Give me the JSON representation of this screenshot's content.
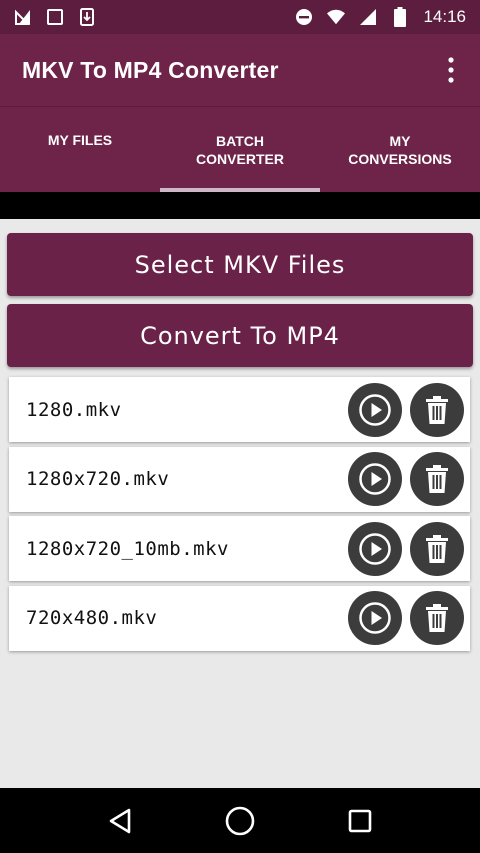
{
  "status_bar": {
    "time": "14:16",
    "icons_left": [
      "no-signal-icon",
      "square-icon",
      "download-icon"
    ],
    "icons_right": [
      "do-not-disturb-icon",
      "wifi-icon",
      "signal-icon",
      "battery-icon"
    ]
  },
  "app_bar": {
    "title": "MKV To MP4 Converter",
    "menu_icon": "overflow-menu-icon"
  },
  "tabs": [
    {
      "label": "MY FILES",
      "active": false
    },
    {
      "label": "BATCH\nCONVERTER",
      "active": true
    },
    {
      "label": "MY\nCONVERSIONS",
      "active": false
    }
  ],
  "actions": {
    "select_label": "Select MKV Files",
    "convert_label": "Convert To MP4"
  },
  "files": [
    {
      "name": "1280.mkv"
    },
    {
      "name": "1280x720.mkv"
    },
    {
      "name": "1280x720_10mb.mkv"
    },
    {
      "name": "720x480.mkv"
    }
  ],
  "nav_bar": {
    "icons": [
      "back-icon",
      "home-icon",
      "recents-icon"
    ]
  },
  "colors": {
    "primary": "#6e2348",
    "primary_dark": "#5c1d3f",
    "tab_indicator": "#cfb6c6",
    "round_button": "#3c3c3c"
  }
}
